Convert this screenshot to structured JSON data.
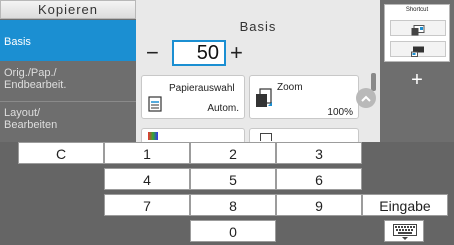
{
  "sidebar": {
    "title": "Kopieren",
    "items": [
      {
        "label": "Basis",
        "active": true
      },
      {
        "label_line1": "Orig./Pap./",
        "label_line2": "Endbearbeit."
      },
      {
        "label_line1": "Layout/",
        "label_line2": "Bearbeiten"
      }
    ]
  },
  "main": {
    "title": "Basis",
    "minus_label": "−",
    "plus_label": "+",
    "copies_value": "50",
    "paper_card": {
      "label": "Papierauswahl",
      "value": "Autom."
    },
    "zoom_card": {
      "label": "Zoom",
      "value": "100%"
    }
  },
  "right_panel": {
    "shortcut_title": "Shortcut",
    "add_label": "+"
  },
  "keypad": {
    "clear_label": "C",
    "keys": [
      "1",
      "2",
      "3",
      "4",
      "5",
      "6",
      "7",
      "8",
      "9",
      "0"
    ],
    "enter_label": "Eingabe"
  },
  "colors": {
    "accent": "#1b8fd2",
    "sidebar_bg": "#6e6e6e",
    "keypad_bg": "#656565"
  },
  "icons": [
    "paper-tray-icon",
    "zoom-icon",
    "chevron-up-icon",
    "shortcut-icon",
    "keyboard-icon"
  ]
}
